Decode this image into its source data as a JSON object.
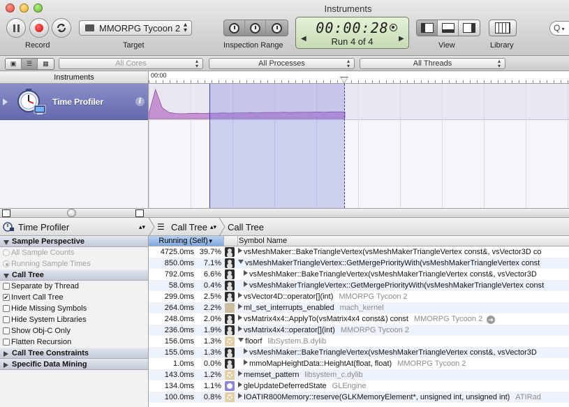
{
  "window": {
    "title": "Instruments"
  },
  "toolbar": {
    "record_label": "Record",
    "target_label": "Target",
    "target_value": "MMORPG Tycoon 2",
    "inspection_range_label": "Inspection Range",
    "timer": "00:00:28",
    "run": "Run 4 of 4",
    "view_label": "View",
    "library_label": "Library",
    "search_placeholder": "Q"
  },
  "filterbar": {
    "cores": "All Cores",
    "processes": "All Processes",
    "threads": "All Threads"
  },
  "tracks": {
    "header": "Instruments",
    "ruler_start": "00:00",
    "instrument_name": "Time Profiler",
    "info_glyph": "i"
  },
  "breadcrumb": {
    "instrument": "Time Profiler",
    "view": "Call Tree",
    "current": "Call Tree"
  },
  "sidebar": {
    "sample_perspective": "Sample Perspective",
    "all_sample_counts": "All Sample Counts",
    "running_sample_times": "Running Sample Times",
    "call_tree": "Call Tree",
    "options": [
      {
        "label": "Separate by Thread",
        "checked": false
      },
      {
        "label": "Invert Call Tree",
        "checked": true
      },
      {
        "label": "Hide Missing Symbols",
        "checked": false
      },
      {
        "label": "Hide System Libraries",
        "checked": false
      },
      {
        "label": "Show Obj-C Only",
        "checked": false
      },
      {
        "label": "Flatten Recursion",
        "checked": false
      }
    ],
    "call_tree_constraints": "Call Tree Constraints",
    "specific_data_mining": "Specific Data Mining"
  },
  "table": {
    "col_running": "Running (Self)",
    "col_symbol": "Symbol Name",
    "rows": [
      {
        "ms": "4725.0ms",
        "pct": "39.7%",
        "icon": "user",
        "indent": 0,
        "tri": "right",
        "symbol": "vsMeshMaker::BakeTriangleVertex(vsMeshMakerTriangleVertex const&, vsVector3D co",
        "lib": ""
      },
      {
        "ms": "850.0ms",
        "pct": "7.1%",
        "icon": "user",
        "indent": 0,
        "tri": "down",
        "symbol": "vsMeshMakerTriangleVertex::GetMergePriorityWith(vsMeshMakerTriangleVertex const",
        "lib": ""
      },
      {
        "ms": "792.0ms",
        "pct": "6.6%",
        "icon": "user",
        "indent": 1,
        "tri": "right",
        "symbol": "vsMeshMaker::BakeTriangleVertex(vsMeshMakerTriangleVertex const&, vsVector3D",
        "lib": ""
      },
      {
        "ms": "58.0ms",
        "pct": "0.4%",
        "icon": "user",
        "indent": 1,
        "tri": "right",
        "symbol": "vsMeshMakerTriangleVertex::GetMergePriorityWith(vsMeshMakerTriangleVertex const",
        "lib": ""
      },
      {
        "ms": "299.0ms",
        "pct": "2.5%",
        "icon": "user",
        "indent": 0,
        "tri": "right",
        "symbol": "vsVector4D::operator[](int)",
        "lib": "MMORPG Tycoon 2"
      },
      {
        "ms": "264.0ms",
        "pct": "2.2%",
        "icon": "kernel",
        "indent": 0,
        "tri": "right",
        "symbol": "ml_set_interrupts_enabled",
        "lib": "mach_kernel"
      },
      {
        "ms": "248.0ms",
        "pct": "2.0%",
        "icon": "user",
        "indent": 0,
        "tri": "right",
        "symbol": "vsMatrix4x4::ApplyTo(vsMatrix4x4 const&) const",
        "lib": "MMORPG Tycoon 2",
        "go": true
      },
      {
        "ms": "236.0ms",
        "pct": "1.9%",
        "icon": "user",
        "indent": 0,
        "tri": "right",
        "symbol": "vsMatrix4x4::operator[](int)",
        "lib": "MMORPG Tycoon 2"
      },
      {
        "ms": "156.0ms",
        "pct": "1.3%",
        "icon": "lib",
        "indent": 0,
        "tri": "down",
        "symbol": "floorf",
        "lib": "libSystem.B.dylib"
      },
      {
        "ms": "155.0ms",
        "pct": "1.3%",
        "icon": "user",
        "indent": 1,
        "tri": "right",
        "symbol": "vsMeshMaker::BakeTriangleVertex(vsMeshMakerTriangleVertex const&, vsVector3D",
        "lib": ""
      },
      {
        "ms": "1.0ms",
        "pct": "0.0%",
        "icon": "user",
        "indent": 1,
        "tri": "right",
        "symbol": "mmoMapHeightData::HeightAt(float, float)",
        "lib": "MMORPG Tycoon 2"
      },
      {
        "ms": "143.0ms",
        "pct": "1.2%",
        "icon": "lib",
        "indent": 0,
        "tri": "right",
        "symbol": "memset_pattern",
        "lib": "libsystem_c.dylib"
      },
      {
        "ms": "134.0ms",
        "pct": "1.1%",
        "icon": "gl",
        "indent": 0,
        "tri": "right",
        "symbol": "gleUpdateDeferredState",
        "lib": "GLEngine"
      },
      {
        "ms": "100.0ms",
        "pct": "0.8%",
        "icon": "lib",
        "indent": 0,
        "tri": "right",
        "symbol": "IOATIR800Memory::reserve(GLKMemoryElement*, unsigned int, unsigned int)",
        "lib": "ATIRad"
      }
    ]
  },
  "colors": {
    "instrument_row": "#6b70b4",
    "selection": "#7882dc",
    "graph_fill": "#b877c6",
    "header_selected": "#8fb4e6"
  },
  "graph": {
    "samples": [
      0.15,
      0.95,
      0.35,
      0.2,
      0.17,
      0.16,
      0.17,
      0.18,
      0.17,
      0.18,
      0.18,
      0.19,
      0.18,
      0.19,
      0.19,
      0.2,
      0.19,
      0.2,
      0.2,
      0.2,
      0.21,
      0.2,
      0.21,
      0.21,
      0.21,
      0.22,
      0.21,
      0.22,
      0.22,
      0.22
    ]
  }
}
